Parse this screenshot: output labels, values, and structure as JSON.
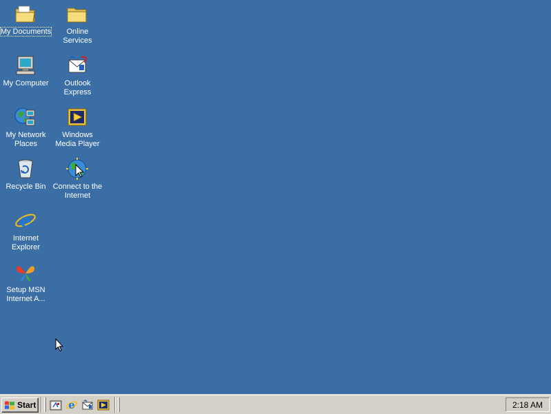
{
  "desktop": {
    "background_color": "#3a6ea5",
    "icons": [
      {
        "label": "My Documents",
        "icon": "my-documents-folder-icon"
      },
      {
        "label": "Online\nServices",
        "icon": "folder-icon"
      },
      {
        "label": "My Computer",
        "icon": "computer-icon"
      },
      {
        "label": "Outlook\nExpress",
        "icon": "outlook-express-icon"
      },
      {
        "label": "My Network\nPlaces",
        "icon": "network-places-icon"
      },
      {
        "label": "Windows\nMedia Player",
        "icon": "media-player-icon"
      },
      {
        "label": "Recycle Bin",
        "icon": "recycle-bin-icon"
      },
      {
        "label": "Connect to the\nInternet",
        "icon": "connect-internet-icon"
      },
      {
        "label": "Internet\nExplorer",
        "icon": "internet-explorer-icon"
      },
      {
        "label": "Setup MSN\nInternet A...",
        "icon": "msn-butterfly-icon"
      }
    ]
  },
  "taskbar": {
    "start_label": "Start",
    "quick_launch": [
      {
        "icon": "show-desktop-icon"
      },
      {
        "icon": "internet-explorer-icon"
      },
      {
        "icon": "outlook-express-icon"
      },
      {
        "icon": "media-player-icon"
      }
    ],
    "clock": "2:18 AM"
  }
}
